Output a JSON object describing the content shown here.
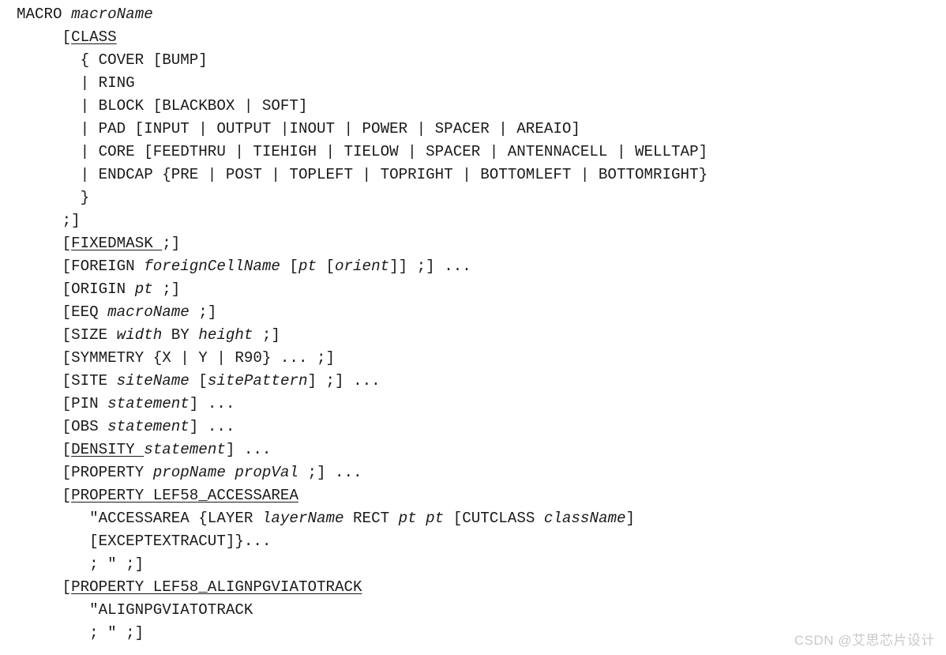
{
  "document": {
    "kind": "lef-macro-syntax-definition",
    "background_color": "#ffffff",
    "text_color": "#1a1a1a",
    "watermark": {
      "text": "CSDN @艾思芯片设计",
      "color": "#c9c9c9"
    }
  },
  "syntax": {
    "lines": [
      {
        "indent": 0,
        "segments": [
          {
            "text": "MACRO ",
            "style": "keyword"
          },
          {
            "text": "macroName",
            "style": "variable"
          }
        ]
      },
      {
        "indent": 0,
        "segments": [
          {
            "text": "     [",
            "style": "keyword"
          },
          {
            "text": "CLASS",
            "style": "keyword-underline"
          }
        ]
      },
      {
        "indent": 0,
        "segments": [
          {
            "text": "       { COVER [BUMP]",
            "style": "keyword"
          }
        ]
      },
      {
        "indent": 0,
        "segments": [
          {
            "text": "       | RING",
            "style": "keyword"
          }
        ]
      },
      {
        "indent": 0,
        "segments": [
          {
            "text": "       | BLOCK [BLACKBOX | SOFT]",
            "style": "keyword"
          }
        ]
      },
      {
        "indent": 0,
        "segments": [
          {
            "text": "       | PAD [INPUT | OUTPUT |INOUT | POWER | SPACER | AREAIO]",
            "style": "keyword"
          }
        ]
      },
      {
        "indent": 0,
        "segments": [
          {
            "text": "       | CORE [FEEDTHRU | TIEHIGH | TIELOW | SPACER | ANTENNACELL | WELLTAP]",
            "style": "keyword"
          }
        ]
      },
      {
        "indent": 0,
        "segments": [
          {
            "text": "       | ENDCAP {PRE | POST | TOPLEFT | TOPRIGHT | BOTTOMLEFT | BOTTOMRIGHT}",
            "style": "keyword"
          }
        ]
      },
      {
        "indent": 0,
        "segments": [
          {
            "text": "       }",
            "style": "keyword"
          }
        ]
      },
      {
        "indent": 0,
        "segments": [
          {
            "text": "     ;]",
            "style": "keyword"
          }
        ]
      },
      {
        "indent": 0,
        "segments": [
          {
            "text": "     [",
            "style": "keyword"
          },
          {
            "text": "FIXEDMASK ",
            "style": "keyword-underline"
          },
          {
            "text": ";]",
            "style": "keyword"
          }
        ]
      },
      {
        "indent": 0,
        "segments": [
          {
            "text": "     [FOREIGN ",
            "style": "keyword"
          },
          {
            "text": "foreignCellName",
            "style": "variable"
          },
          {
            "text": " [",
            "style": "keyword"
          },
          {
            "text": "pt",
            "style": "variable"
          },
          {
            "text": " [",
            "style": "keyword"
          },
          {
            "text": "orient",
            "style": "variable"
          },
          {
            "text": "]] ;] ...",
            "style": "keyword"
          }
        ]
      },
      {
        "indent": 0,
        "segments": [
          {
            "text": "     [ORIGIN ",
            "style": "keyword"
          },
          {
            "text": "pt",
            "style": "variable"
          },
          {
            "text": " ;]",
            "style": "keyword"
          }
        ]
      },
      {
        "indent": 0,
        "segments": [
          {
            "text": "     [EEQ ",
            "style": "keyword"
          },
          {
            "text": "macroName",
            "style": "variable"
          },
          {
            "text": " ;]",
            "style": "keyword"
          }
        ]
      },
      {
        "indent": 0,
        "segments": [
          {
            "text": "     [SIZE ",
            "style": "keyword"
          },
          {
            "text": "width",
            "style": "variable"
          },
          {
            "text": " BY ",
            "style": "keyword"
          },
          {
            "text": "height",
            "style": "variable"
          },
          {
            "text": " ;]",
            "style": "keyword"
          }
        ]
      },
      {
        "indent": 0,
        "segments": [
          {
            "text": "     [SYMMETRY {X | Y | R90} ... ;]",
            "style": "keyword"
          }
        ]
      },
      {
        "indent": 0,
        "segments": [
          {
            "text": "     [SITE ",
            "style": "keyword"
          },
          {
            "text": "siteName",
            "style": "variable"
          },
          {
            "text": " [",
            "style": "keyword"
          },
          {
            "text": "sitePattern",
            "style": "variable"
          },
          {
            "text": "] ;] ...",
            "style": "keyword"
          }
        ]
      },
      {
        "indent": 0,
        "segments": [
          {
            "text": "     [PIN ",
            "style": "keyword"
          },
          {
            "text": "statement",
            "style": "variable"
          },
          {
            "text": "] ...",
            "style": "keyword"
          }
        ]
      },
      {
        "indent": 0,
        "segments": [
          {
            "text": "     [OBS ",
            "style": "keyword"
          },
          {
            "text": "statement",
            "style": "variable"
          },
          {
            "text": "] ...",
            "style": "keyword"
          }
        ]
      },
      {
        "indent": 0,
        "segments": [
          {
            "text": "     [",
            "style": "keyword"
          },
          {
            "text": "DENSITY ",
            "style": "keyword-underline"
          },
          {
            "text": "statement",
            "style": "variable"
          },
          {
            "text": "] ...",
            "style": "keyword"
          }
        ]
      },
      {
        "indent": 0,
        "segments": [
          {
            "text": "     [PROPERTY ",
            "style": "keyword"
          },
          {
            "text": "propName propVal",
            "style": "variable"
          },
          {
            "text": " ;] ...",
            "style": "keyword"
          }
        ]
      },
      {
        "indent": 0,
        "segments": [
          {
            "text": "     [",
            "style": "keyword"
          },
          {
            "text": "PROPERTY LEF58_ACCESSAREA",
            "style": "keyword-underline"
          }
        ]
      },
      {
        "indent": 0,
        "segments": [
          {
            "text": "        \"ACCESSAREA {LAYER ",
            "style": "keyword"
          },
          {
            "text": "layerName",
            "style": "variable"
          },
          {
            "text": " RECT ",
            "style": "keyword"
          },
          {
            "text": "pt pt",
            "style": "variable"
          },
          {
            "text": " [CUTCLASS ",
            "style": "keyword"
          },
          {
            "text": "className",
            "style": "variable"
          },
          {
            "text": "]",
            "style": "keyword"
          }
        ]
      },
      {
        "indent": 0,
        "segments": [
          {
            "text": "        [EXCEPTEXTRACUT]}...",
            "style": "keyword"
          }
        ]
      },
      {
        "indent": 0,
        "segments": [
          {
            "text": "        ; \" ;]",
            "style": "keyword"
          }
        ]
      },
      {
        "indent": 0,
        "segments": [
          {
            "text": "     [",
            "style": "keyword"
          },
          {
            "text": "PROPERTY LEF58_ALIGNPGVIATOTRACK",
            "style": "keyword-underline"
          }
        ]
      },
      {
        "indent": 0,
        "segments": [
          {
            "text": "        \"ALIGNPGVIATOTRACK",
            "style": "keyword"
          }
        ]
      },
      {
        "indent": 0,
        "segments": [
          {
            "text": "        ; \" ;]",
            "style": "keyword"
          }
        ]
      }
    ]
  }
}
